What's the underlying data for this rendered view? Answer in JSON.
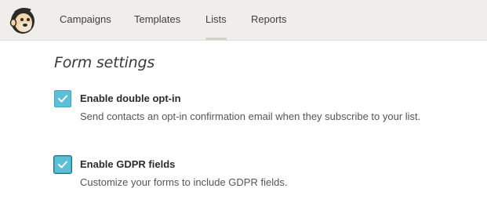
{
  "nav": {
    "items": [
      {
        "label": "Campaigns"
      },
      {
        "label": "Templates"
      },
      {
        "label": "Lists",
        "active": true
      },
      {
        "label": "Reports"
      }
    ]
  },
  "main": {
    "title": "Form settings",
    "options": [
      {
        "label": "Enable double opt-in",
        "description": "Send contacts an opt-in confirmation email when they subscribe to your list.",
        "checked": true
      },
      {
        "label": "Enable GDPR fields",
        "description": "Customize your forms to include GDPR fields.",
        "checked": true
      }
    ]
  },
  "icons": {
    "logo": "mailchimp-freddie-logo",
    "checkmark": "check-icon"
  },
  "colors": {
    "checkbox_fill": "#5bbfd8",
    "topbar_bg": "#efeeea"
  }
}
